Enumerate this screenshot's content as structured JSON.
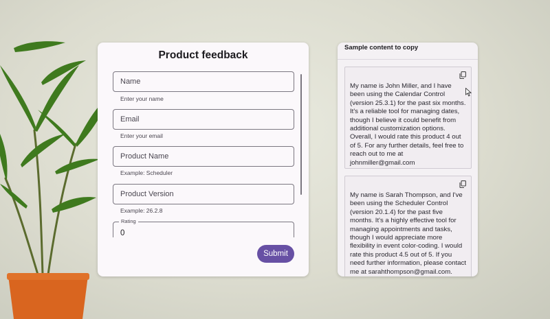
{
  "form": {
    "title": "Product feedback",
    "fields": [
      {
        "label": "Name",
        "hint": "Enter your name"
      },
      {
        "label": "Email",
        "hint": "Enter your email"
      },
      {
        "label": "Product Name",
        "hint": "Example: Scheduler"
      },
      {
        "label": "Product Version",
        "hint": "Example: 26.2.8"
      }
    ],
    "rating": {
      "label": "Rating",
      "value": "0"
    },
    "submit_label": "Submit"
  },
  "sample": {
    "title": "Sample content to copy",
    "items": [
      {
        "text": "My name is John Miller, and I have been using the Calendar Control (version 25.3.1) for the past six months. It's a reliable tool for managing dates, though I believe it could benefit from additional customization options. Overall, I would rate this product 4 out of 5. For any further details, feel free to reach out to me at johnmiller@gmail.com",
        "icon": "copy-icon"
      },
      {
        "text": "My name is Sarah Thompson, and I've been using the Scheduler Control (version 20.1.4) for the past five months. It's a highly effective tool for managing appointments and tasks, though I would appreciate more flexibility in event color-coding. I would rate this product 4.5 out of 5. If you need further information, please contact me at sarahthompson@gmail.com.",
        "icon": "copy-icon"
      }
    ]
  },
  "colors": {
    "accent": "#6750a4",
    "card": "#fbf8fb"
  }
}
